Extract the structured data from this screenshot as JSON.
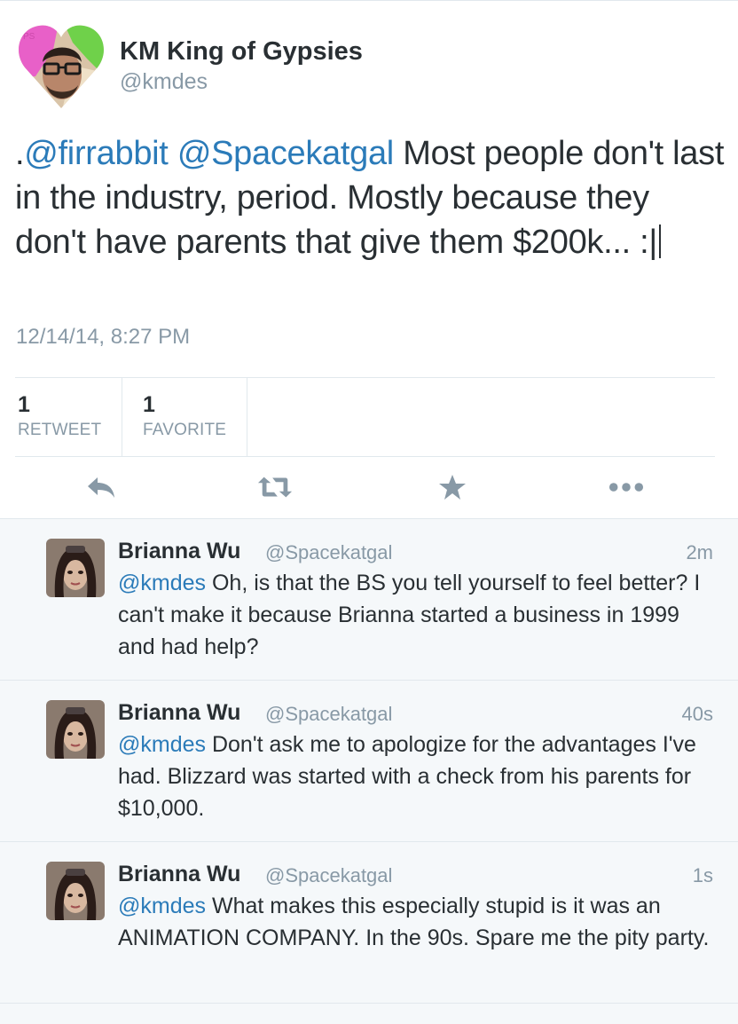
{
  "tweet": {
    "author_name": "KM King of Gypsies",
    "author_handle": "@kmdes",
    "text_prefix": ".",
    "mention_1": "@firrabbit",
    "mention_2": "@Spacekatgal",
    "text_body": "Most people don't last in the industry, period. Mostly because they don't have parents that give them $200k... :|",
    "timestamp": "12/14/14, 8:27 PM",
    "retweet_count": "1",
    "retweet_label": "RETWEET",
    "favorite_count": "1",
    "favorite_label": "FAVORITE"
  },
  "actions": {
    "reply_icon": "reply-arrow-icon",
    "retweet_icon": "retweet-icon",
    "favorite_icon": "star-icon",
    "more_icon": "ellipsis-icon"
  },
  "replies": [
    {
      "name": "Brianna Wu",
      "handle": "@Spacekatgal",
      "time": "2m",
      "mention": "@kmdes",
      "text": "Oh, is that the BS you tell yourself to feel better? I can't make it because Brianna started a business in 1999 and had help?"
    },
    {
      "name": "Brianna Wu",
      "handle": "@Spacekatgal",
      "time": "40s",
      "mention": "@kmdes",
      "text": "Don't ask me to apologize for the advantages I've had. Blizzard was started with a check from his parents for $10,000."
    },
    {
      "name": "Brianna Wu",
      "handle": "@Spacekatgal",
      "time": "1s",
      "mention": "@kmdes",
      "text": "What makes this especially stupid is it was an ANIMATION COMPANY. In the 90s. Spare me the pity party."
    }
  ],
  "colors": {
    "link": "#2b7bb9",
    "secondary_text": "#8899a6",
    "primary_text": "#292f33",
    "divider": "#e1e8ed",
    "reply_bg": "#f5f8fa"
  }
}
